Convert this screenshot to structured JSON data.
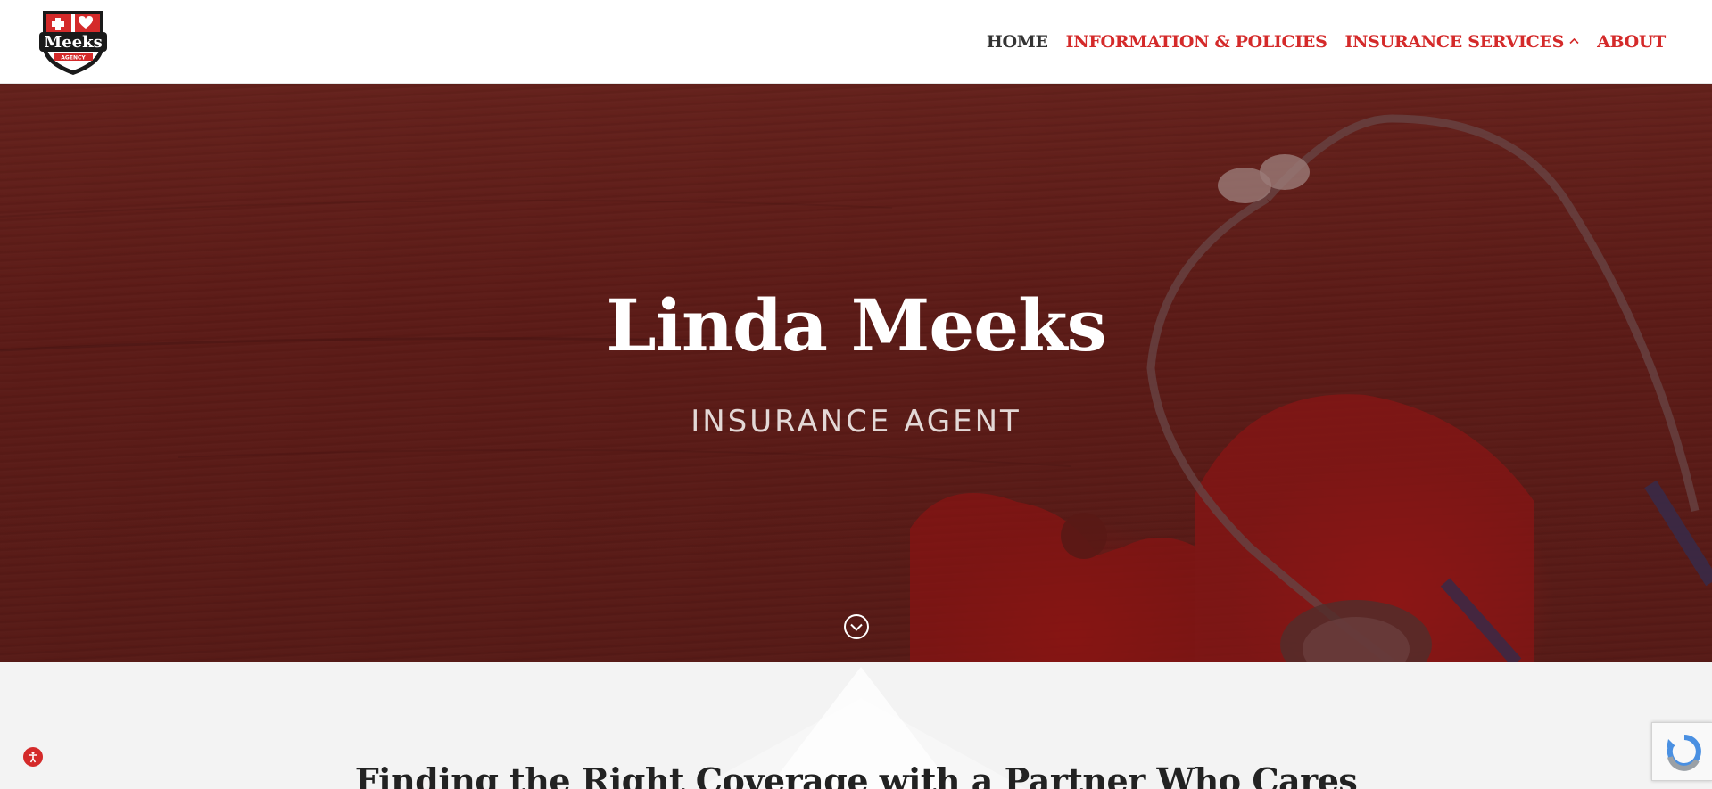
{
  "header": {
    "logo": {
      "text": "Meeks",
      "subtext": "AGENCY",
      "alt": "Meeks Agency logo"
    },
    "nav": [
      {
        "label": "HOME",
        "active": true
      },
      {
        "label": "INFORMATION & POLICIES",
        "active": false
      },
      {
        "label": "INSURANCE SERVICES",
        "active": false,
        "icon": "chevron-up-icon"
      },
      {
        "label": "ABOUT",
        "active": false
      }
    ]
  },
  "hero": {
    "title": "Linda Meeks",
    "subtitle": "INSURANCE AGENT",
    "scroll_icon": "chevron-down-circle-icon"
  },
  "intro": {
    "heading": "Finding the Right Coverage with a Partner Who Cares"
  },
  "widgets": {
    "accessibility_icon": "accessibility-icon",
    "recaptcha_icon": "recaptcha-icon"
  },
  "colors": {
    "accent": "#d42a2a",
    "nav_active": "#333333",
    "hero_overlay": "#5a1210",
    "section_bg": "#f3f3f3"
  }
}
